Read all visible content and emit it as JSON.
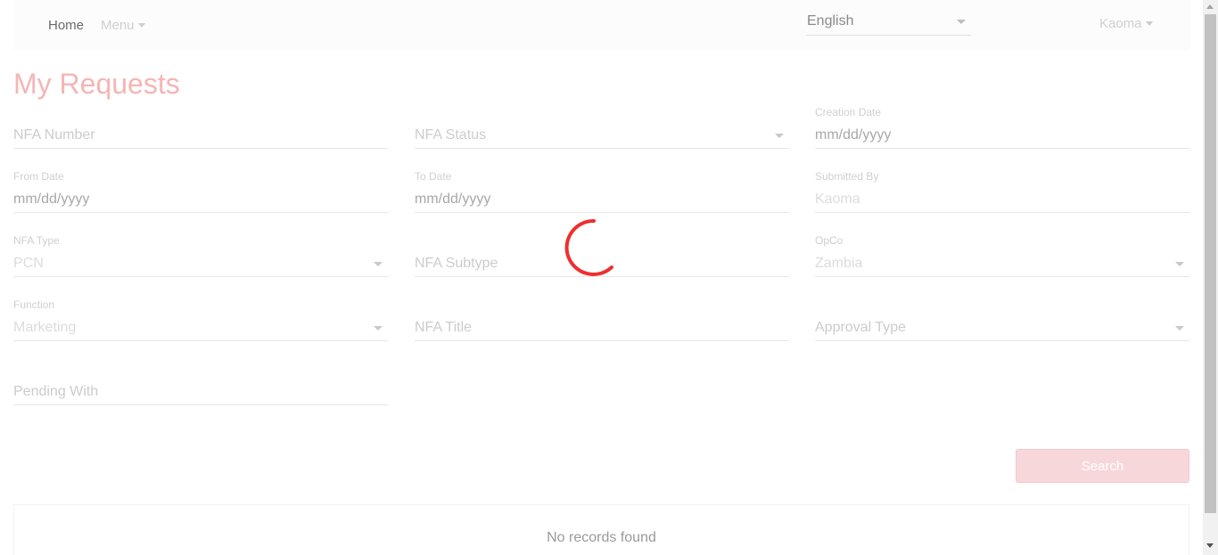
{
  "navbar": {
    "home_label": "Home",
    "menu_label": "Menu",
    "language": "English",
    "user": "Kaoma"
  },
  "page": {
    "title": "My Requests"
  },
  "form": {
    "nfa_number": {
      "placeholder": "NFA Number"
    },
    "nfa_status": {
      "placeholder": "NFA Status"
    },
    "creation_date": {
      "label": "Creation Date",
      "placeholder": "mm/dd/yyyy"
    },
    "from_date": {
      "label": "From Date",
      "placeholder": "mm/dd/yyyy"
    },
    "to_date": {
      "label": "To Date",
      "placeholder": "mm/dd/yyyy"
    },
    "submitted_by": {
      "label": "Submitted By",
      "value": "Kaoma"
    },
    "nfa_type": {
      "label": "NFA Type",
      "value": "PCN"
    },
    "nfa_subtype": {
      "placeholder": "NFA Subtype"
    },
    "opco": {
      "label": "OpCo",
      "value": "Zambia"
    },
    "function": {
      "label": "Function",
      "value": "Marketing"
    },
    "nfa_title": {
      "placeholder": "NFA Title"
    },
    "approval_type": {
      "placeholder": "Approval Type"
    },
    "pending_with": {
      "placeholder": "Pending With"
    },
    "search_label": "Search"
  },
  "results": {
    "empty_text": "No records found"
  },
  "colors": {
    "accent": "#e53935",
    "title": "#f5b5b5",
    "search_button": "#f8d7da"
  }
}
